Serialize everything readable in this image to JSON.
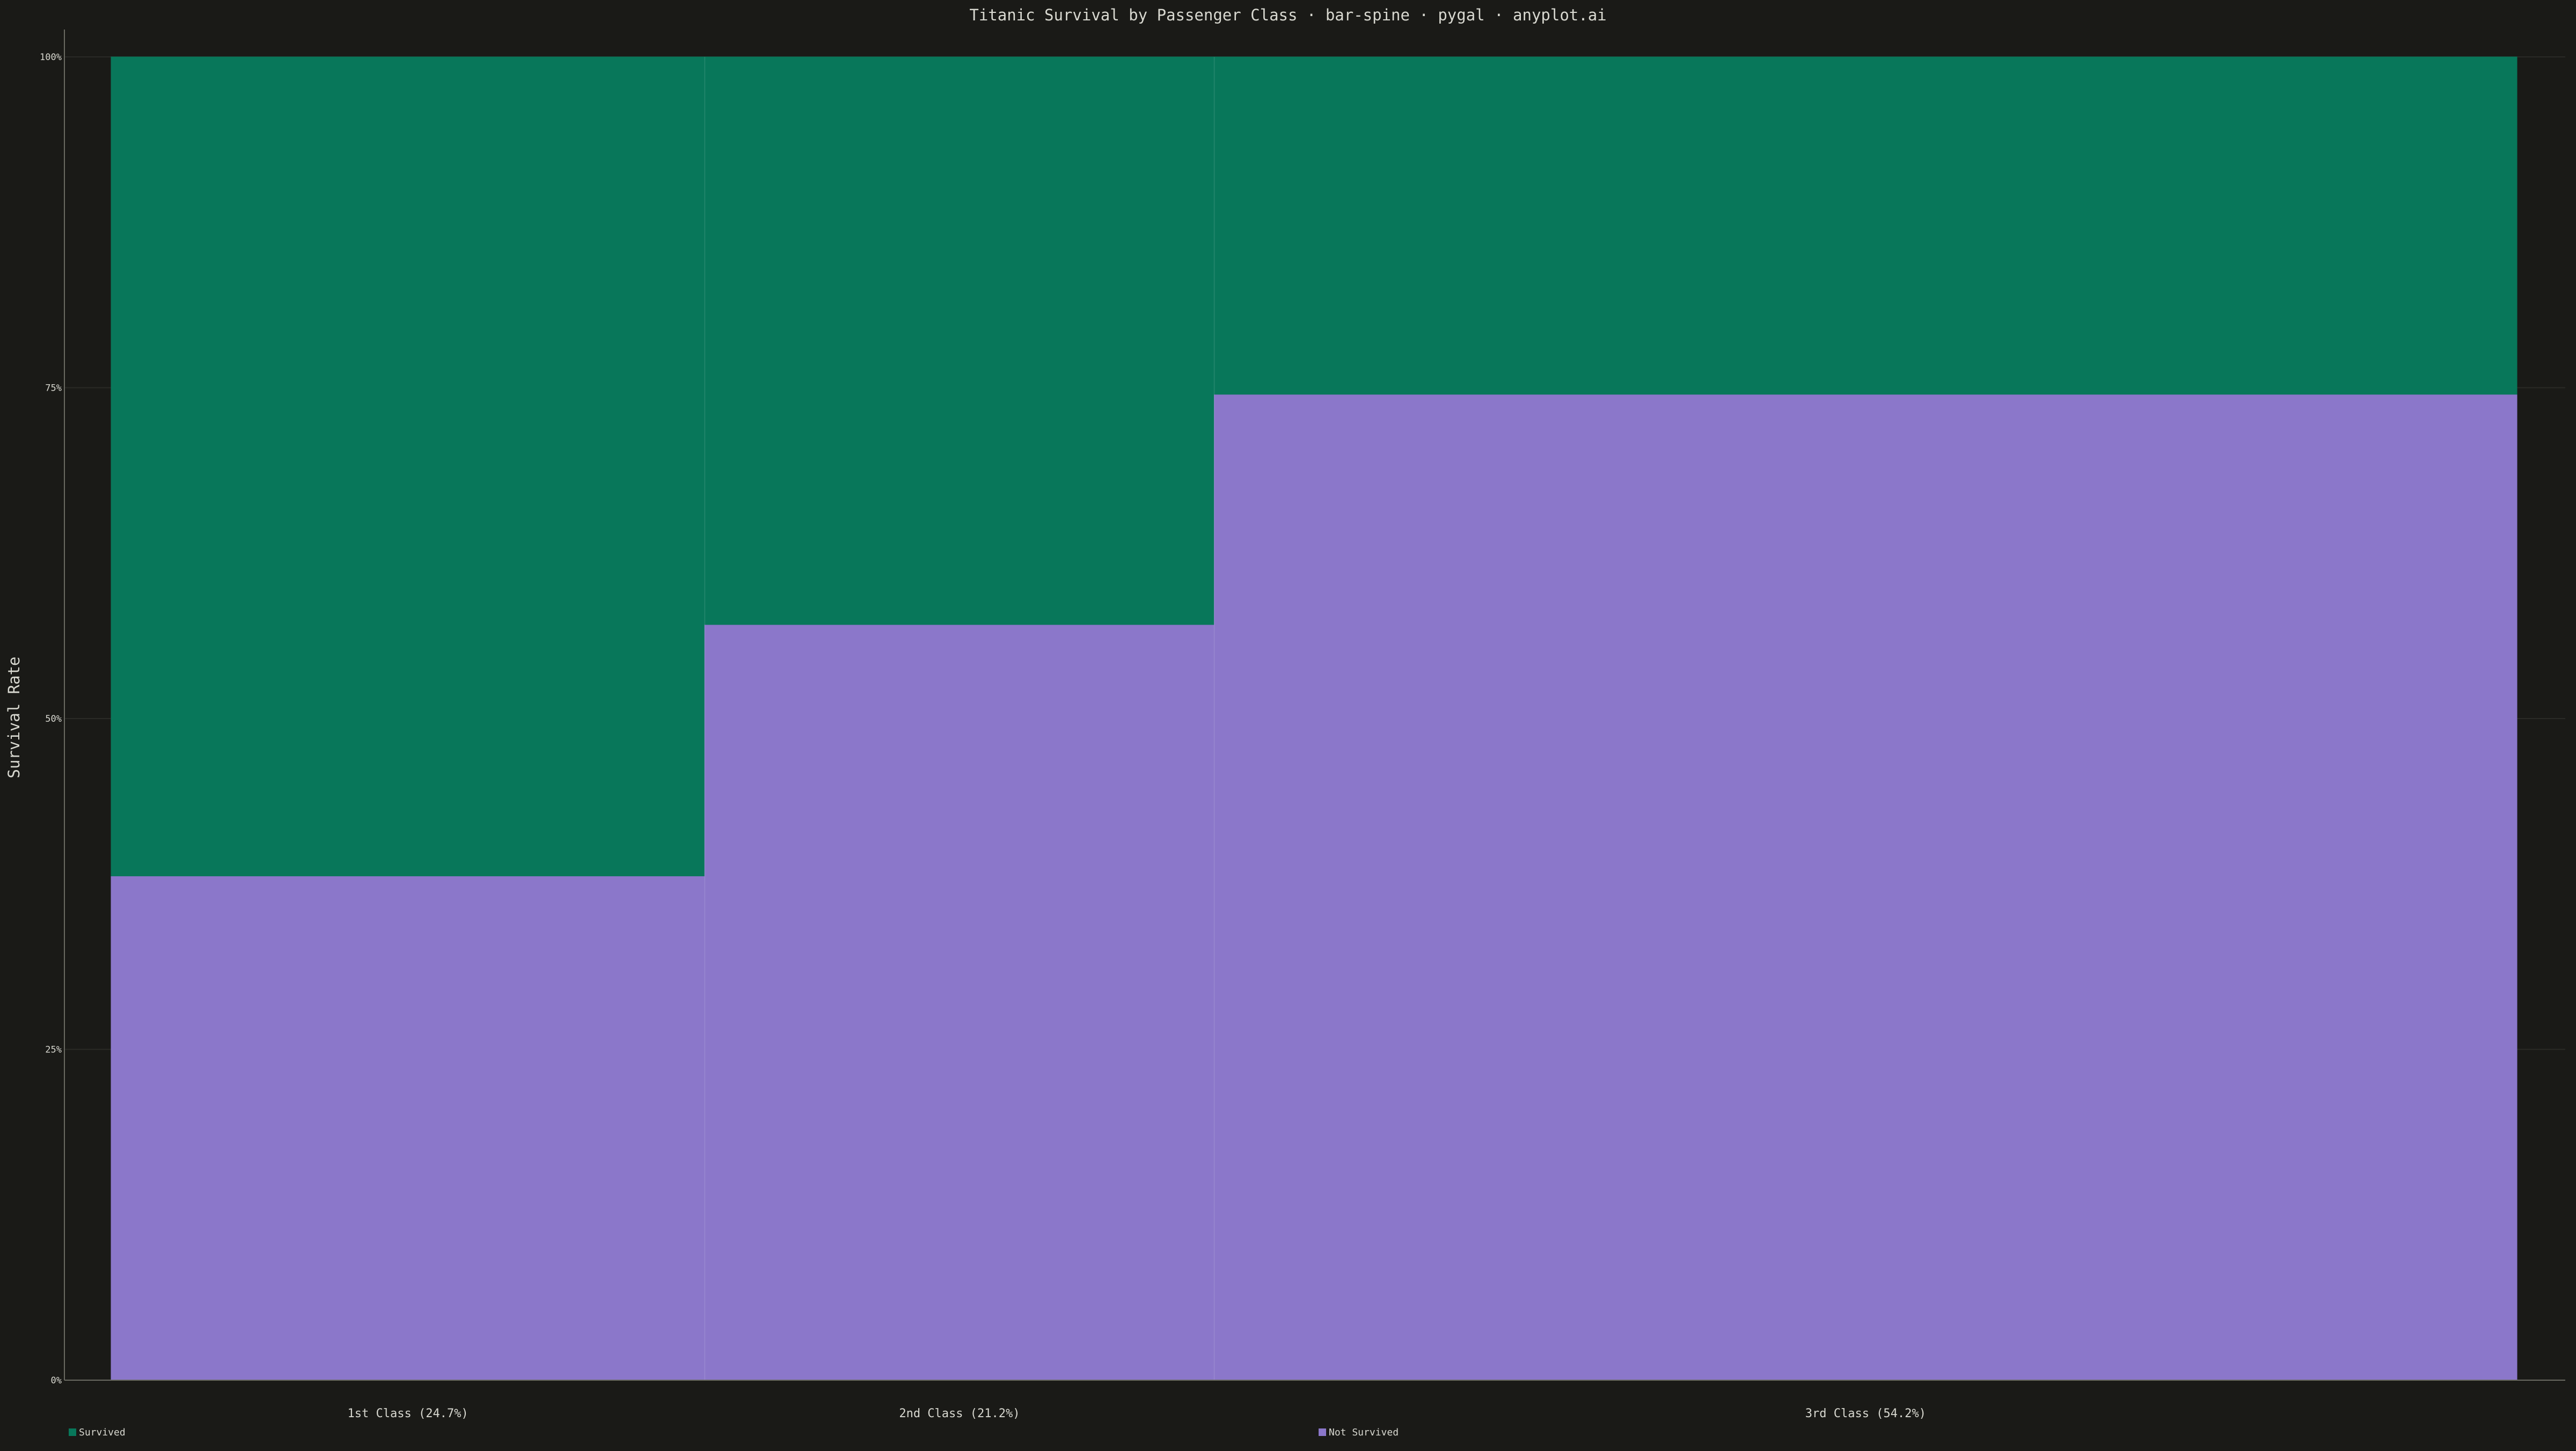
{
  "chart_data": {
    "type": "bar",
    "subtype": "stacked-variable-width (mosaic)",
    "title": "Titanic Survival by Passenger Class · bar-spine · pygal · anyplot.ai",
    "ylabel": "Survival Rate",
    "xlabel": "",
    "ylim": [
      0,
      100
    ],
    "y_unit": "%",
    "yticks": [
      "0%",
      "25%",
      "50%",
      "75%",
      "100%"
    ],
    "ytick_values": [
      0,
      25,
      50,
      75,
      100
    ],
    "categories": [
      "1st Class (24.7%)",
      "2nd Class (21.2%)",
      "3rd Class (54.2%)"
    ],
    "category_share_percent": [
      24.7,
      21.2,
      54.2
    ],
    "series": [
      {
        "name": "Not Survived",
        "color": "#8b77ca",
        "values": [
          38.1,
          57.1,
          74.5
        ]
      },
      {
        "name": "Survived",
        "color": "#08775a",
        "values": [
          61.9,
          42.9,
          25.5
        ]
      }
    ],
    "legend_position": "bottom",
    "grid": true,
    "background_color": "#1a1a17",
    "text_color": "#d8d8d0",
    "axis_color": "#6a6a62"
  }
}
